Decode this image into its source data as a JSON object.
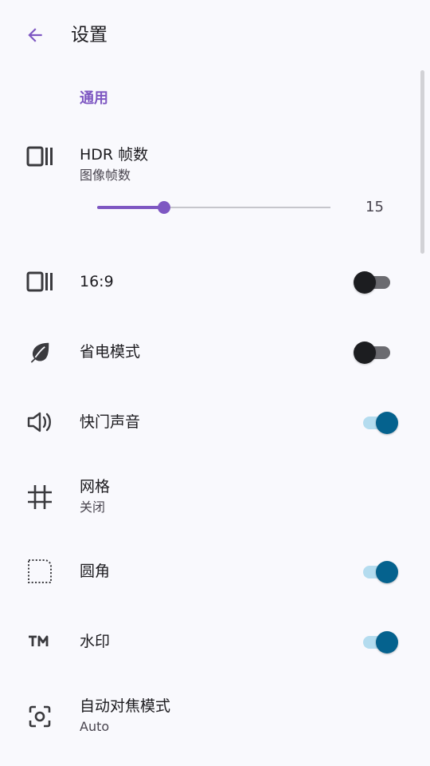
{
  "app_bar": {
    "title": "设置",
    "back_icon": "arrow-back-icon"
  },
  "colors": {
    "accent": "#7e57c2",
    "switch_on_thumb": "#05628e",
    "switch_on_track": "#b4dcef",
    "switch_off_thumb": "#1c1d20",
    "switch_off_track": "#6b6b70",
    "background": "#f9f9fd"
  },
  "section": {
    "label": "通用"
  },
  "settings": [
    {
      "id": "hdr_frames",
      "icon": "aspect-frame-icon",
      "title": "HDR 帧数",
      "subtitle": "图像帧数",
      "slider": {
        "value": 15,
        "fraction": 0.285
      }
    },
    {
      "id": "aspect_16_9",
      "icon": "aspect-frame-icon",
      "title": "16:9",
      "switch_on": false
    },
    {
      "id": "power_saving",
      "icon": "leaf-icon",
      "title": "省电模式",
      "switch_on": false
    },
    {
      "id": "shutter_sound",
      "icon": "volume-icon",
      "title": "快门声音",
      "switch_on": true
    },
    {
      "id": "grid",
      "icon": "grid-icon",
      "title": "网格",
      "subtitle": "关闭"
    },
    {
      "id": "rounded_corners",
      "icon": "rounded-corner-icon",
      "title": "圆角",
      "switch_on": true
    },
    {
      "id": "watermark",
      "icon": "trademark-icon",
      "title": "水印",
      "switch_on": true
    },
    {
      "id": "autofocus_mode",
      "icon": "focus-camera-icon",
      "title": "自动对焦模式",
      "subtitle": "Auto"
    }
  ]
}
